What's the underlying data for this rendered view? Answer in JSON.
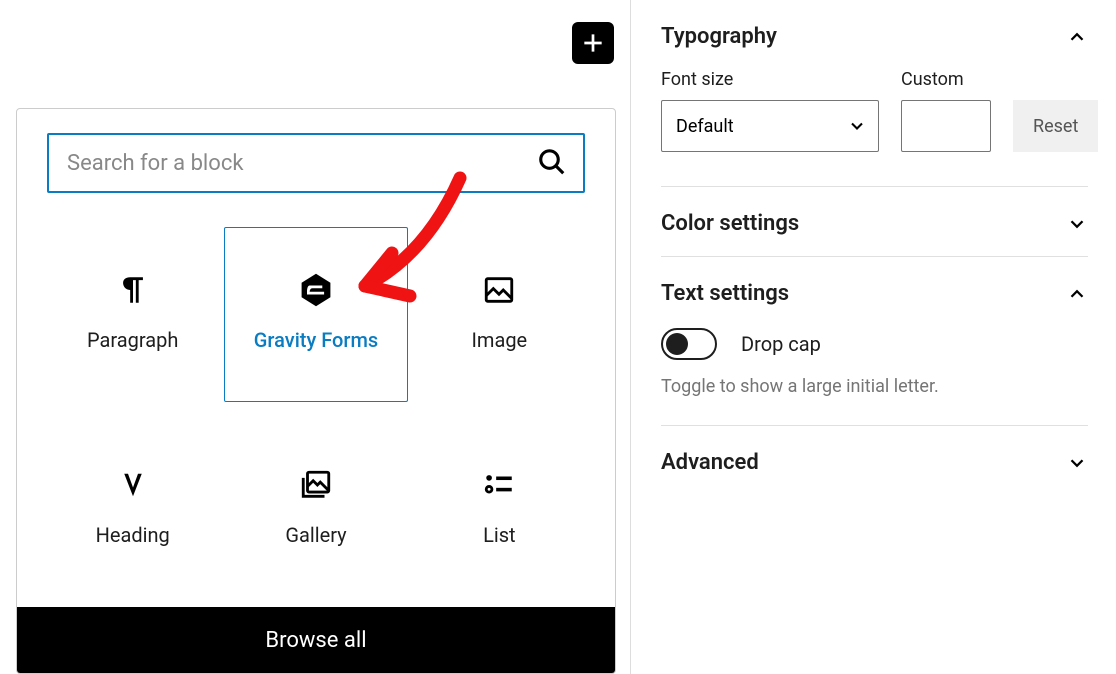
{
  "inserter": {
    "search_placeholder": "Search for a block",
    "blocks": [
      {
        "label": "Paragraph"
      },
      {
        "label": "Gravity Forms"
      },
      {
        "label": "Image"
      },
      {
        "label": "Heading"
      },
      {
        "label": "Gallery"
      },
      {
        "label": "List"
      }
    ],
    "browse_all": "Browse all"
  },
  "sidebar": {
    "typography": {
      "title": "Typography",
      "font_size_label": "Font size",
      "font_size_value": "Default",
      "custom_label": "Custom",
      "custom_value": "",
      "reset_label": "Reset"
    },
    "color": {
      "title": "Color settings"
    },
    "text": {
      "title": "Text settings",
      "dropcap_label": "Drop cap",
      "dropcap_help": "Toggle to show a large initial letter."
    },
    "advanced": {
      "title": "Advanced"
    }
  }
}
